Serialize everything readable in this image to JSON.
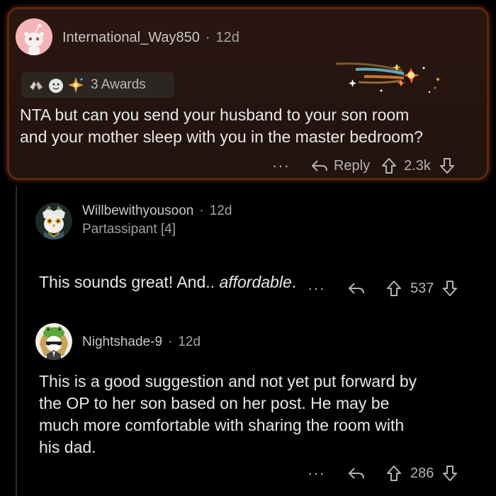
{
  "comment_main": {
    "author": "International_Way850",
    "separator": "·",
    "age": "12d",
    "awards_label": "3 Awards",
    "body": "NTA but can you send your husband to your son room\nand your mother sleep with you in the master bedroom?",
    "more": "···",
    "reply_label": "Reply",
    "score": "2.3k"
  },
  "reply_1": {
    "author": "Willbewithyousoon",
    "separator": "·",
    "age": "12d",
    "flair": "Partassipant [4]",
    "body_prefix": "This sounds great! And.. ",
    "body_italic": "affordable",
    "body_suffix": ".",
    "more": "···",
    "score": "537"
  },
  "reply_2": {
    "author": "Nightshade-9",
    "separator": "·",
    "age": "12d",
    "body": "This is a good suggestion and not yet put forward by\nthe OP to her son based on her post. He may be\nmuch more comfortable with sharing the room with\nhis dad.",
    "more": "···",
    "score": "286"
  },
  "icons": [
    "snoo-avatar-icon",
    "award-hands-icon",
    "award-wholesome-icon",
    "award-sparkle-icon",
    "comet-banner-icon",
    "reply-arrow-icon",
    "upvote-icon",
    "downvote-icon"
  ],
  "colors": {
    "highlight_border": "#5a2812",
    "highlight_bg": "#2a1610",
    "background": "#000000",
    "text": "#e8e8e8",
    "muted": "#a5a5a5"
  }
}
